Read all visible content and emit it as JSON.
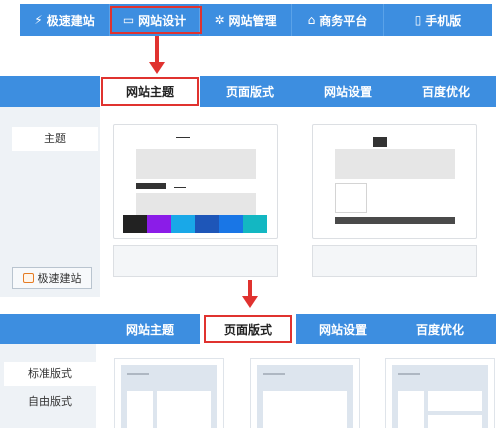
{
  "top_nav": {
    "items": [
      {
        "icon": "lightning-icon",
        "label": "极速建站"
      },
      {
        "icon": "monitor-icon",
        "label": "网站设计"
      },
      {
        "icon": "gear-icon",
        "label": "网站管理"
      },
      {
        "icon": "home-icon",
        "label": "商务平台"
      },
      {
        "icon": "mobile-icon",
        "label": "手机版"
      }
    ],
    "highlighted": "网站设计"
  },
  "panel_theme": {
    "tabs": [
      "网站主题",
      "页面版式",
      "网站设置",
      "百度优化"
    ],
    "active_tab": "网站主题",
    "sidebar": {
      "items": [
        "主题"
      ],
      "quick_build_button": "极速建站"
    },
    "color_swatches": [
      "#222222",
      "#8b1ce8",
      "#19a8e8",
      "#1e56b8",
      "#1976e6",
      "#13b7c2"
    ]
  },
  "panel_layout": {
    "tabs": [
      "网站主题",
      "页面版式",
      "网站设置",
      "百度优化"
    ],
    "active_tab": "页面版式",
    "sidebar": {
      "items": [
        "标准版式",
        "自由版式"
      ]
    }
  },
  "colors": {
    "accent": "#3d8ee0",
    "highlight": "#e0322f"
  }
}
